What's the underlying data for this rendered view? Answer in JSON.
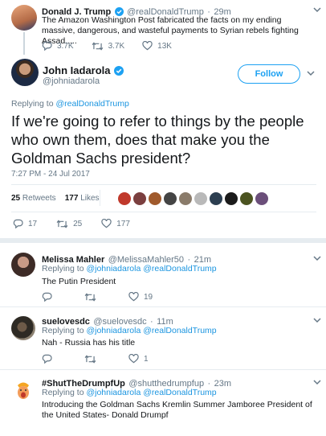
{
  "parent_tweet": {
    "name": "Donald J. Trump",
    "handle": "@realDonaldTrump",
    "time": "29m",
    "text": "The Amazon Washington Post fabricated the facts on my ending massive, dangerous, and wasteful payments to Syrian rebels fighting Assad.....",
    "replies": "3.7K",
    "retweets": "3.7K",
    "likes": "13K"
  },
  "main_tweet": {
    "name": "John Iadarola",
    "handle": "@johniadarola",
    "follow_label": "Follow",
    "replying_to_prefix": "Replying to",
    "replying_to": "@realDonaldTrump",
    "text": "If we're going to refer to things by the people who own them, does that make you the Goldman Sachs president?",
    "timestamp": "7:27 PM - 24 Jul 2017",
    "retweets_count": "25",
    "retweets_label": "Retweets",
    "likes_count": "177",
    "likes_label": "Likes",
    "action_replies": "17",
    "action_retweets": "25",
    "action_likes": "177",
    "liker_colors": [
      "#c0392b",
      "#7b3f3f",
      "#a05a2c",
      "#444444",
      "#8a7b6a",
      "#b9b9b9",
      "#2c3e50",
      "#1b1b1b",
      "#4b5320",
      "#6b4f7a"
    ]
  },
  "replies": [
    {
      "name": "Melissa Mahler",
      "handle": "@MelissaMahler50",
      "time": "21m",
      "replying_prefix": "Replying to",
      "replying_to": "@johniadarola @realDonaldTrump",
      "text": "The Putin President",
      "likes": "19"
    },
    {
      "name": "suelovesdc",
      "handle": "@suelovesdc",
      "time": "11m",
      "replying_prefix": "Replying to",
      "replying_to": "@johniadarola @realDonaldTrump",
      "text": "Nah - Russia has his title",
      "likes": "1"
    },
    {
      "name": "#ShutTheDrumpfUp",
      "handle": "@shutthedrumpfup",
      "time": "23m",
      "replying_prefix": "Replying to",
      "replying_to": "@johniadarola @realDonaldTrump",
      "text": "Introducing the Goldman Sachs Kremlin Summer Jamboree President of the United States- Donald Drumpf",
      "likes": ""
    }
  ],
  "colors": {
    "accent": "#1da1f2",
    "link": "#1b95e0",
    "muted": "#657786",
    "verified": "#1da1f2"
  }
}
